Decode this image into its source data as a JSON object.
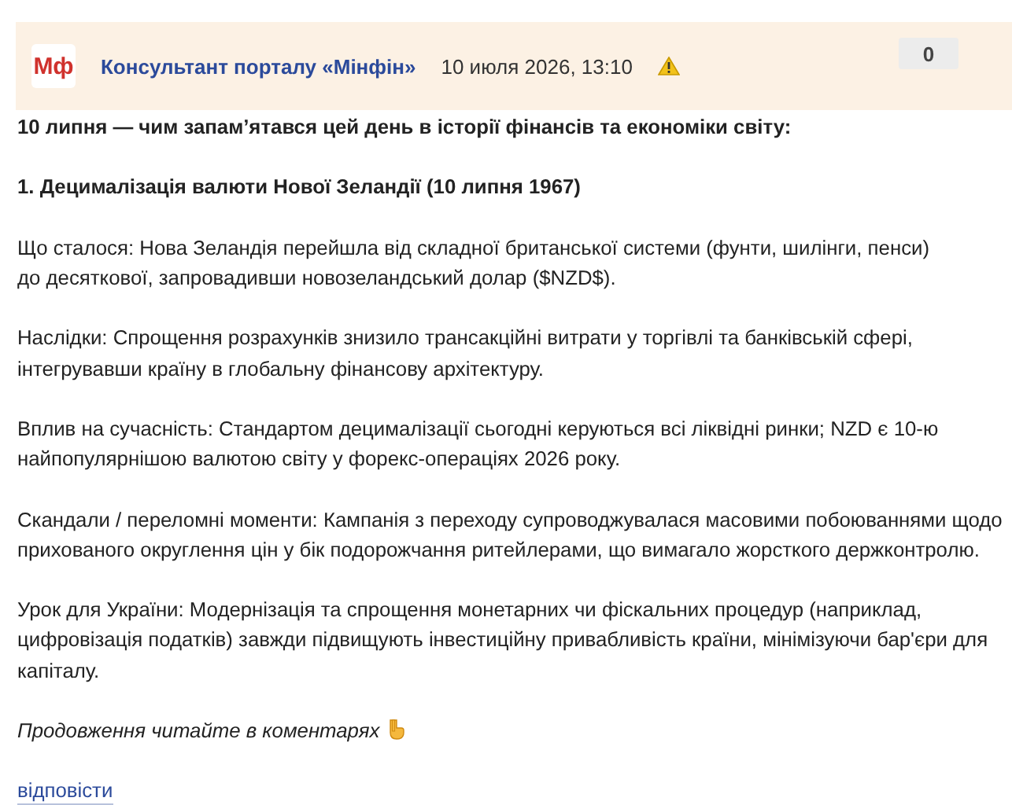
{
  "header": {
    "logo": "Мф",
    "author": "Консультант порталу «Мінфін»",
    "date": "10 июля 2026, 13:10",
    "counter": "0"
  },
  "paragraphs": [
    {
      "kind": "bold",
      "lines": [
        "10 липня — чим запам’ятався цей день в історії фінансів та економіки світу:"
      ]
    },
    {
      "kind": "bold",
      "lines": [
        "1. Децималізація валюти Нової Зеландії (10 липня 1967)"
      ]
    },
    {
      "kind": "plain",
      "lines": [
        "Що сталося: Нова Зеландія перейшла від складної британської системи (фунти, шилінги, пенси)",
        "до десяткової, запровадивши новозеландський долар ($NZD$)."
      ]
    },
    {
      "kind": "plain",
      "lines": [
        "Наслідки: Спрощення розрахунків знизило трансакційні витрати у торгівлі та банківській сфері,",
        "інтегрувавши країну в глобальну фінансову архітектуру."
      ]
    },
    {
      "kind": "plain",
      "lines": [
        "Вплив на сучасність: Стандартом децималізації сьогодні керуються всі ліквідні ринки; NZD є 10-ю",
        "найпопулярнішою валютою світу у форекс-операціях 2026 року."
      ]
    },
    {
      "kind": "plain",
      "lines": [
        "Скандали / переломні моменти: Кампанія з переходу супроводжувалася масовими побоюваннями щодо",
        "прихованого округлення цін у бік подорожчання ритейлерами, що вимагало жорсткого держконтролю."
      ]
    },
    {
      "kind": "plain",
      "lines": [
        "Урок для України: Модернізація та спрощення монетарних чи фіскальних процедур (наприклад,",
        "цифровізація податків) завжди підвищують інвестиційну привабливість країни, мінімізуючи бар'єри для",
        "капіталу."
      ]
    },
    {
      "kind": "italic",
      "lines": [
        "Продовження читайте в коментарях"
      ],
      "pointer": true
    }
  ],
  "reply_link": "відповісти"
}
